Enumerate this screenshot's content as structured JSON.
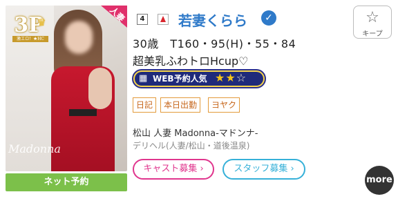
{
  "profile": {
    "rank": "4",
    "name": "若妻くらら",
    "stats": "30歳　T160・95(H)・55・84",
    "catchphrase": "超美乳ふわトロHcup♡",
    "photo_badge": "3P",
    "photo_badge_sub": "激エロ！★HC",
    "ribbon": "人妻",
    "watermark": "Madonna",
    "net_reserve_label": "ネット予約"
  },
  "keep": {
    "label": "キープ",
    "icon": "star-outline-icon"
  },
  "web_popularity": {
    "label": "WEB予約人気",
    "stars_filled": 2,
    "stars_total": 3,
    "icon": "calendar-icon"
  },
  "tags": [
    "日記",
    "本日出勤",
    "ヨヤク"
  ],
  "shop": {
    "line": "松山 人妻 Madonna-マドンナ-",
    "genre": "デリヘル(人妻/松山・道後温泉)"
  },
  "recruit": {
    "cast_label": "キャスト募集 ›",
    "staff_label": "スタッフ募集 ›"
  },
  "more_label": "more",
  "colors": {
    "name": "#2f7ac9",
    "net_button": "#7cc04a",
    "tag_border": "#e39a3a",
    "cast_recruit": "#e0358d",
    "staff_recruit": "#35b0d8",
    "web_badge_bg": "#1f2a7a",
    "star_on": "#f3c31a"
  }
}
